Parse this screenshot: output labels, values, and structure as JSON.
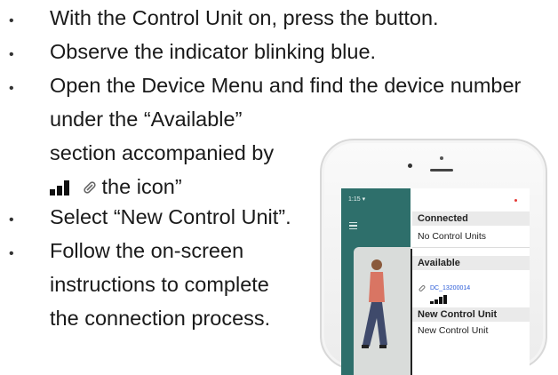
{
  "instructions": {
    "bullet": "•",
    "line1": "With the Control Unit on, press the button.",
    "line2": "Observe the indicator blinking blue.",
    "line3a": "Open the Device Menu and find the device number",
    "line3b": "under the “Available”",
    "line3c": "section accompanied by",
    "line3d": "the  icon”",
    "line4": "Select “New Control Unit”.",
    "line5a": "Follow the on-screen",
    "line5b": "instructions to complete",
    "line5c": "the connection process."
  },
  "phone": {
    "status_time": "1:15 ▾",
    "connected_header": "Connected",
    "connected_value": "No Control Units",
    "available_header": "Available",
    "device_id": "DC_13200014",
    "new_unit_header": "New Control Unit",
    "new_unit_value": "New Control Unit"
  },
  "icons": [
    "signal-bars-icon",
    "link-icon",
    "hamburger-menu-icon"
  ]
}
